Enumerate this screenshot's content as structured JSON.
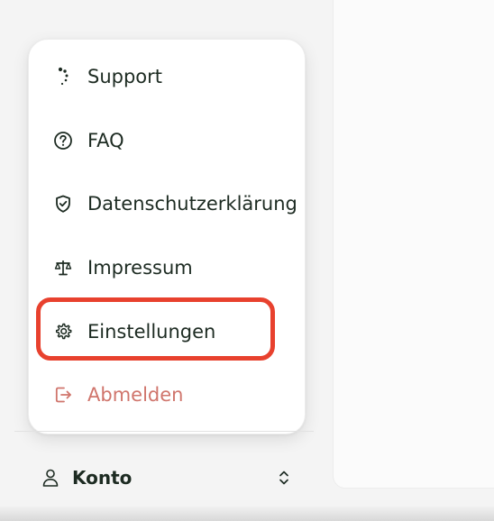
{
  "menu": {
    "items": [
      {
        "label": "Support",
        "icon": "support-spinner-icon"
      },
      {
        "label": "FAQ",
        "icon": "question-circle-icon"
      },
      {
        "label": "Datenschutzerklärung",
        "icon": "shield-check-icon"
      },
      {
        "label": "Impressum",
        "icon": "scales-icon"
      },
      {
        "label": "Einstellungen",
        "icon": "gear-icon"
      },
      {
        "label": "Abmelden",
        "icon": "logout-icon"
      }
    ]
  },
  "account": {
    "label": "Konto",
    "icon": "user-icon",
    "toggle_icon": "chevron-up-down-icon"
  },
  "colors": {
    "text": "#1d2b22",
    "logout": "#d0756c",
    "highlight": "#e8412e"
  }
}
